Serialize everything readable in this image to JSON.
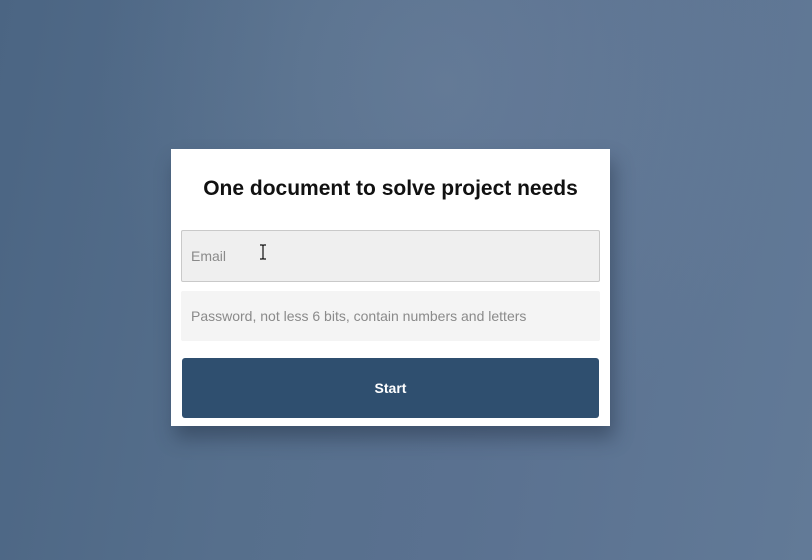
{
  "login": {
    "title": "One document to solve project needs",
    "email": {
      "value": "",
      "placeholder": "Email"
    },
    "password": {
      "value": "",
      "placeholder": "Password, not less 6 bits, contain numbers and letters"
    },
    "start_label": "Start"
  },
  "colors": {
    "button": "#2f4f6f",
    "background": "#566f8c"
  },
  "icons": {
    "pointer": "text-cursor-icon"
  }
}
